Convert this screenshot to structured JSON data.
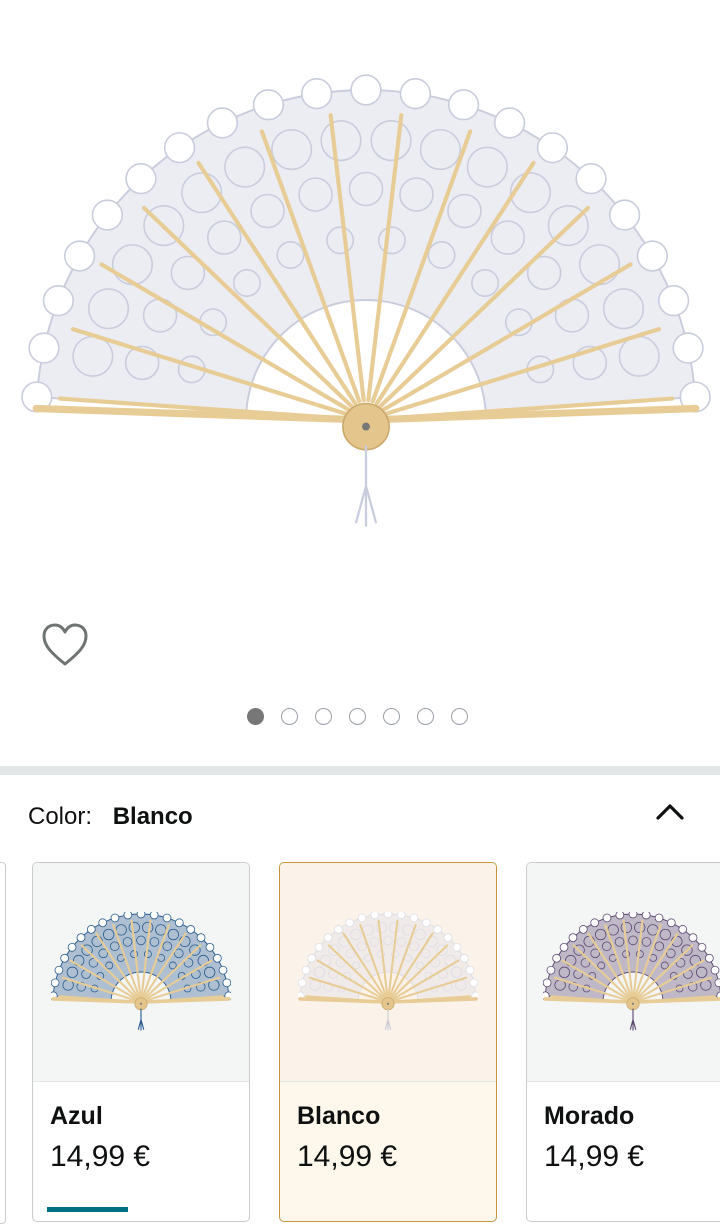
{
  "gallery": {
    "image_alt": "Abanico de encaje blanco",
    "dots": [
      {
        "active": true
      },
      {
        "active": false
      },
      {
        "active": false
      },
      {
        "active": false
      },
      {
        "active": false
      },
      {
        "active": false
      },
      {
        "active": false
      }
    ]
  },
  "variation": {
    "label": "Color:",
    "selected": "Blanco",
    "options": [
      {
        "name": "Azul",
        "price": "14,99 €",
        "lace_color": "#2a5d8f",
        "selected": false
      },
      {
        "name": "Blanco",
        "price": "14,99 €",
        "lace_color": "#dcdde6",
        "selected": true
      },
      {
        "name": "Morado",
        "price": "14,99 €",
        "lace_color": "#5c4a72",
        "selected": false
      }
    ]
  },
  "colors": {
    "accent": "#007185",
    "selected_border": "#c7963a",
    "wood": "#e8cc96",
    "divider": "#e3e6e6"
  }
}
